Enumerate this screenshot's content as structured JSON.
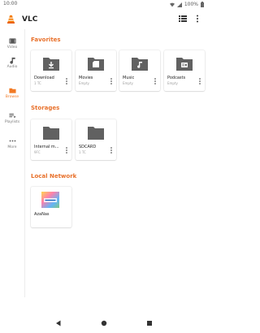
{
  "status_bar": {
    "time": "10:00",
    "battery": "100%"
  },
  "app": {
    "title": "VLC"
  },
  "side_nav": [
    {
      "label": "Video",
      "icon": "video-icon"
    },
    {
      "label": "Audio",
      "icon": "music-note-icon"
    },
    {
      "label": "Browse",
      "icon": "folder-icon",
      "active": true
    },
    {
      "label": "Playlists",
      "icon": "playlist-icon"
    },
    {
      "label": "More",
      "icon": "more-horiz-icon"
    }
  ],
  "sections": {
    "favorites": "Favorites",
    "storages": "Storages",
    "local_network": "Local Network"
  },
  "favorites": [
    {
      "title": "Download",
      "subtitle": "1 TC",
      "icon": "download-folder-icon"
    },
    {
      "title": "Movies",
      "subtitle": "Empty",
      "icon": "movie-folder-icon"
    },
    {
      "title": "Music",
      "subtitle": "Empty",
      "icon": "music-folder-icon"
    },
    {
      "title": "Podcasts",
      "subtitle": "Empty",
      "icon": "podcast-folder-icon"
    }
  ],
  "storages": [
    {
      "title": "Internal m...",
      "subtitle": "9FC",
      "icon": "folder-icon"
    },
    {
      "title": "SDCARD",
      "subtitle": "1 TC",
      "icon": "folder-icon"
    }
  ],
  "local_network": [
    {
      "title": "AzaNas",
      "icon": "nas-icon"
    }
  ],
  "colors": {
    "accent": "#e8702a",
    "folder_gray": "#616161"
  }
}
